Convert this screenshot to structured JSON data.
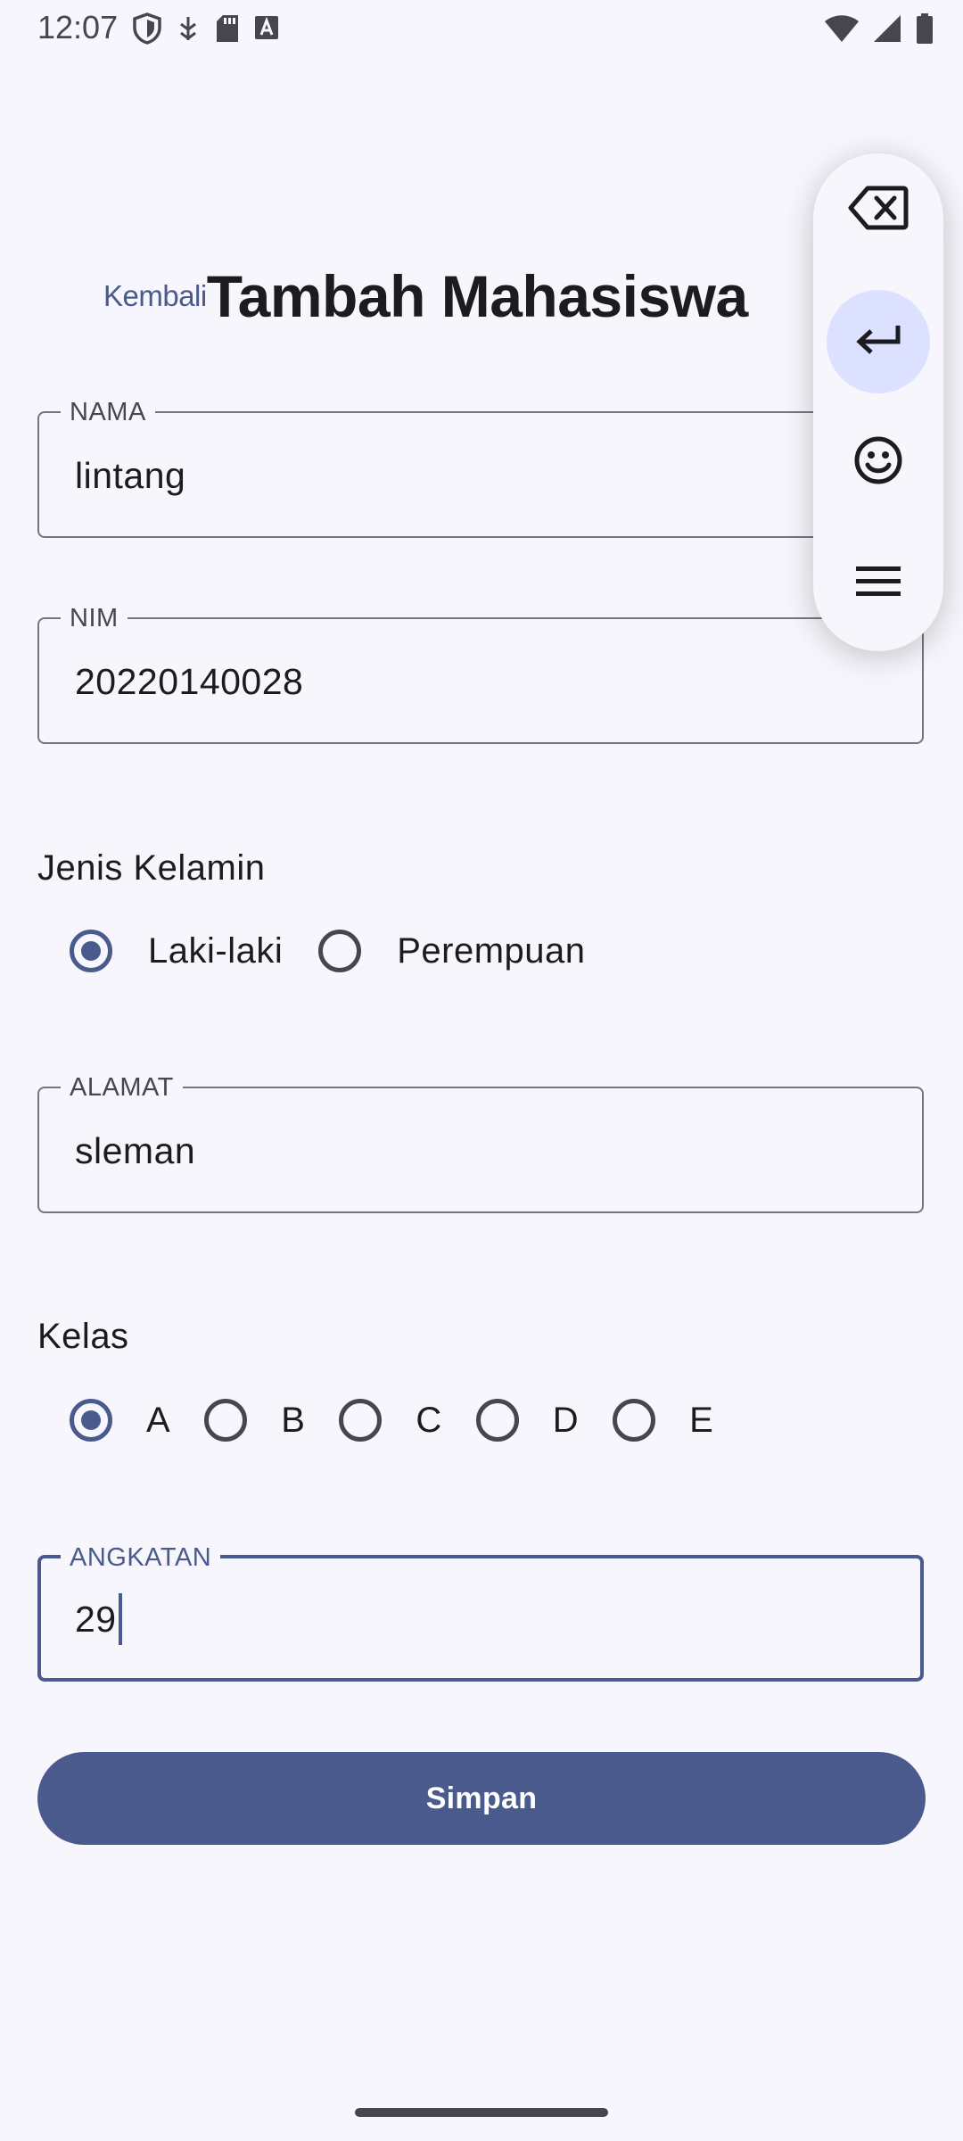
{
  "status_bar": {
    "time": "12:07",
    "left_icons": [
      "shield-icon",
      "usb-debug-icon",
      "sd-card-icon",
      "keyboard-a-icon"
    ],
    "right_icons": [
      "wifi-icon",
      "signal-icon",
      "battery-icon"
    ]
  },
  "header": {
    "back_label": "Kembali",
    "title": "Tambah Mahasiswa"
  },
  "form": {
    "nama": {
      "label": "NAMA",
      "value": "lintang"
    },
    "nim": {
      "label": "NIM",
      "value": "20220140028"
    },
    "jenis_kelamin": {
      "label": "Jenis Kelamin",
      "options": [
        "Laki-laki",
        "Perempuan"
      ],
      "selected": "Laki-laki"
    },
    "alamat": {
      "label": "ALAMAT",
      "value": "sleman"
    },
    "kelas": {
      "label": "Kelas",
      "options": [
        "A",
        "B",
        "C",
        "D",
        "E"
      ],
      "selected": "A"
    },
    "angkatan": {
      "label": "ANGKATAN",
      "value": "29"
    },
    "submit_label": "Simpan"
  },
  "keyboard_toolbar": {
    "buttons": [
      "backspace-icon",
      "enter-icon",
      "emoji-icon",
      "menu-icon"
    ],
    "active": "enter-icon"
  },
  "colors": {
    "primary": "#4a5a8c",
    "background": "#f7f6fc",
    "active_chip": "#dce1ff",
    "outline": "#76757f"
  }
}
